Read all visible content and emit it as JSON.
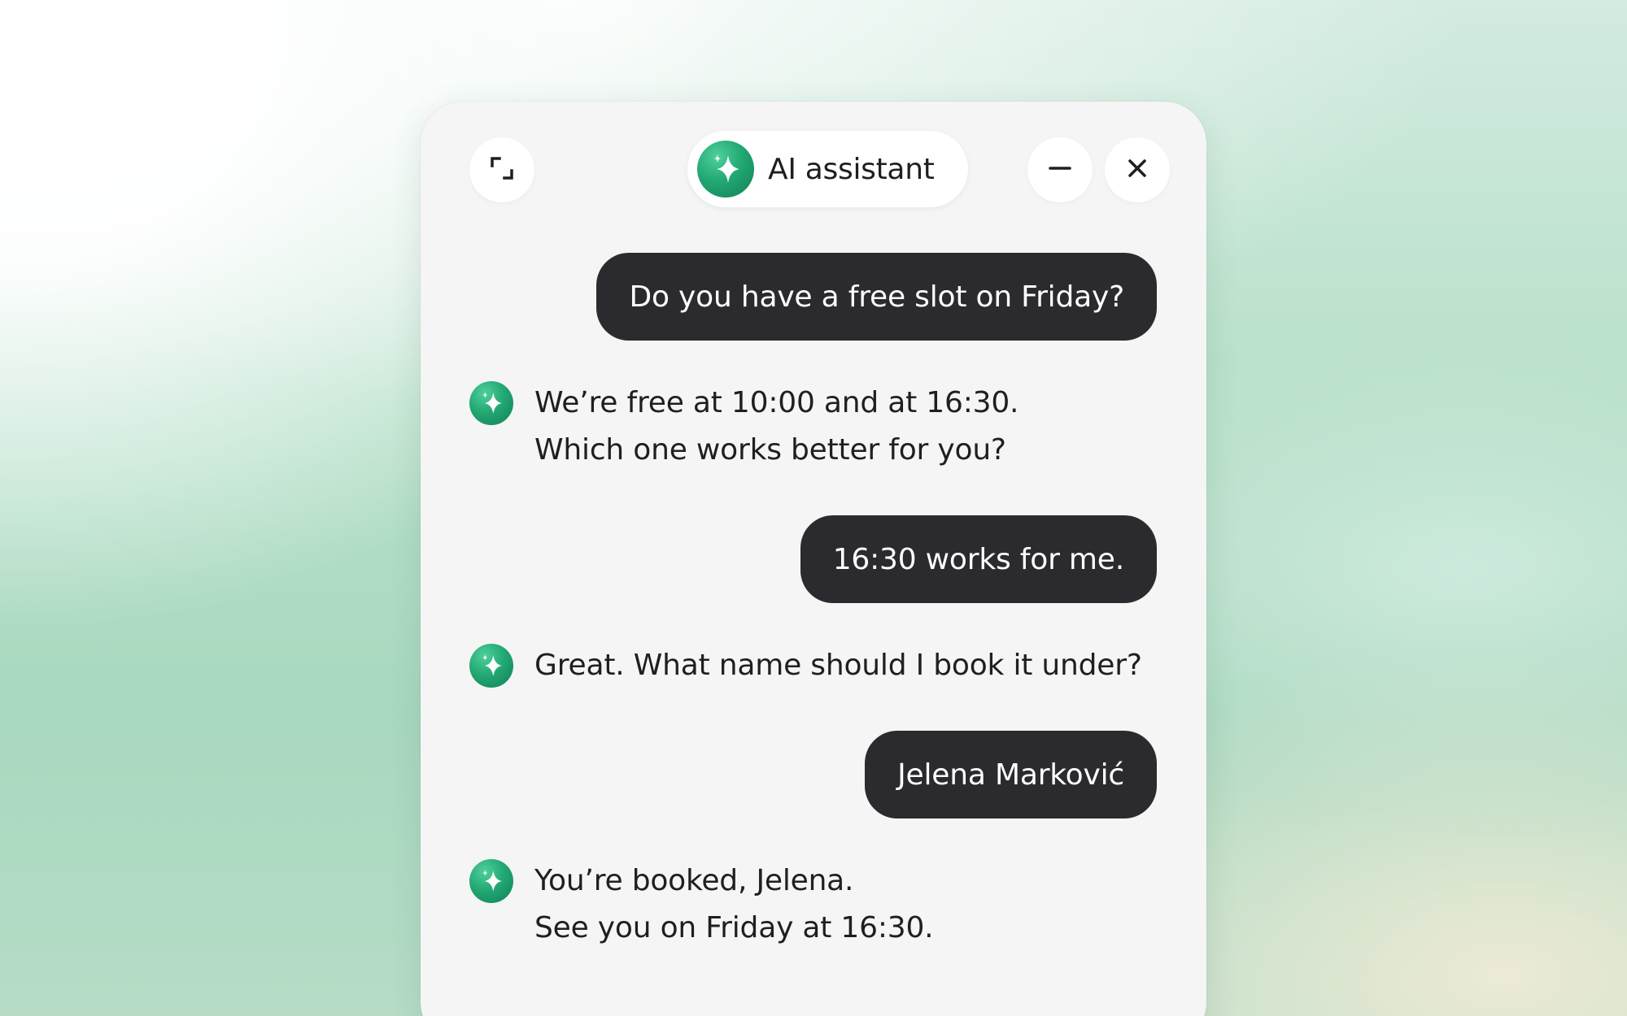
{
  "widget": {
    "title": "AI assistant",
    "expand_icon": "expand-icon",
    "minimize_icon": "minimize-icon",
    "close_icon": "close-icon",
    "avatar_icon": "sparkle-icon",
    "accent_color": "#1f9e6c",
    "user_bubble_color": "#2b2b2f",
    "panel_color": "#f5f5f5"
  },
  "messages": [
    {
      "role": "user",
      "text": "Do you have a free slot on Friday?"
    },
    {
      "role": "assistant",
      "lines": [
        "We’re free at 10:00 and at 16:30.",
        "Which one works better for you?"
      ]
    },
    {
      "role": "user",
      "text": "16:30 works for me."
    },
    {
      "role": "assistant",
      "lines": [
        "Great. What name should I book it under?"
      ]
    },
    {
      "role": "user",
      "text": "Jelena Marković"
    },
    {
      "role": "assistant",
      "lines": [
        "You’re booked, Jelena.",
        "See you on Friday at 16:30."
      ]
    }
  ]
}
